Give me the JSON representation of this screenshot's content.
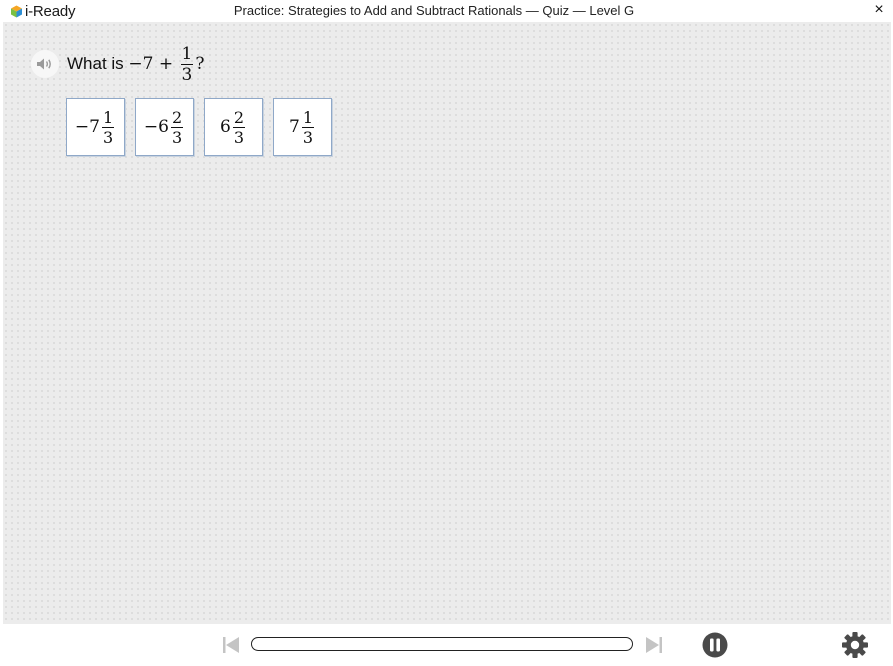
{
  "app": {
    "logo_text": "i-Ready",
    "window_title": "Practice: Strategies to Add and Subtract Rationals — Quiz — Level G",
    "close_glyph": "×"
  },
  "question": {
    "prefix": "What is ",
    "expression_lead": "−7 + ",
    "fraction": {
      "numerator": "1",
      "denominator": "3"
    },
    "suffix": "?"
  },
  "answers": [
    {
      "whole": "−7",
      "numerator": "1",
      "denominator": "3"
    },
    {
      "whole": "−6",
      "numerator": "2",
      "denominator": "3"
    },
    {
      "whole": "6",
      "numerator": "2",
      "denominator": "3"
    },
    {
      "whole": "7",
      "numerator": "1",
      "denominator": "3"
    }
  ],
  "footer": {
    "progress": 0
  },
  "icons": {
    "logo": "i-ready-logo-icon",
    "audio": "speaker-icon",
    "prev": "skip-back-icon",
    "next": "skip-forward-icon",
    "pause": "pause-icon",
    "settings": "gear-icon",
    "close": "close-icon"
  },
  "colors": {
    "answer_border": "#8fa8c8",
    "stage_background": "#ececec",
    "logo_orange": "#f5a623",
    "logo_green": "#7ac143",
    "logo_blue": "#2d8fd5"
  }
}
